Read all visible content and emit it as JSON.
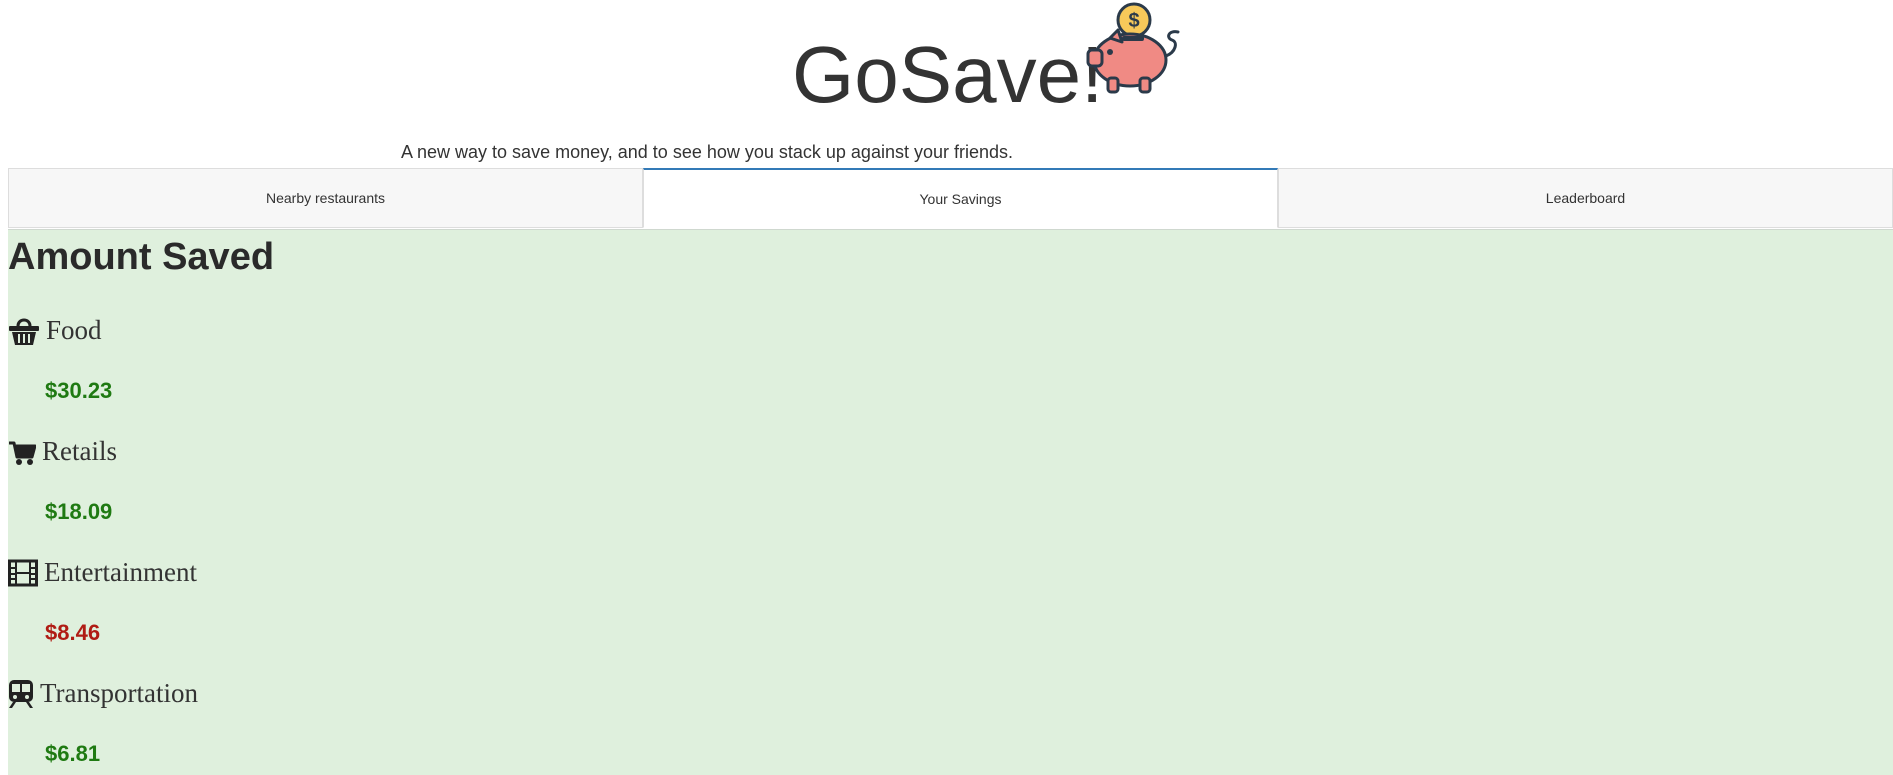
{
  "header": {
    "title": "GoSave!",
    "tagline": "A new way to save money, and to see how you stack up against your friends.",
    "logo_icon": "piggy-bank-icon"
  },
  "tabs": [
    {
      "label": "Nearby restaurants",
      "active": false
    },
    {
      "label": "Your Savings",
      "active": true
    },
    {
      "label": "Leaderboard",
      "active": false
    }
  ],
  "savings": {
    "title": "Amount Saved",
    "categories": [
      {
        "label": "Food",
        "icon": "basket-icon",
        "amount": "$30.23",
        "status": "positive"
      },
      {
        "label": "Retails",
        "icon": "shopping-cart-icon",
        "amount": "$18.09",
        "status": "positive"
      },
      {
        "label": "Entertainment",
        "icon": "film-icon",
        "amount": "$8.46",
        "status": "negative"
      },
      {
        "label": "Transportation",
        "icon": "train-icon",
        "amount": "$6.81",
        "status": "positive"
      }
    ]
  },
  "colors": {
    "panel_bg": "#dff0dd",
    "positive": "#1f7a12",
    "negative": "#b01c14",
    "active_tab_border": "#337ab7",
    "pig": "#f08a84",
    "coin": "#f7c95a"
  }
}
